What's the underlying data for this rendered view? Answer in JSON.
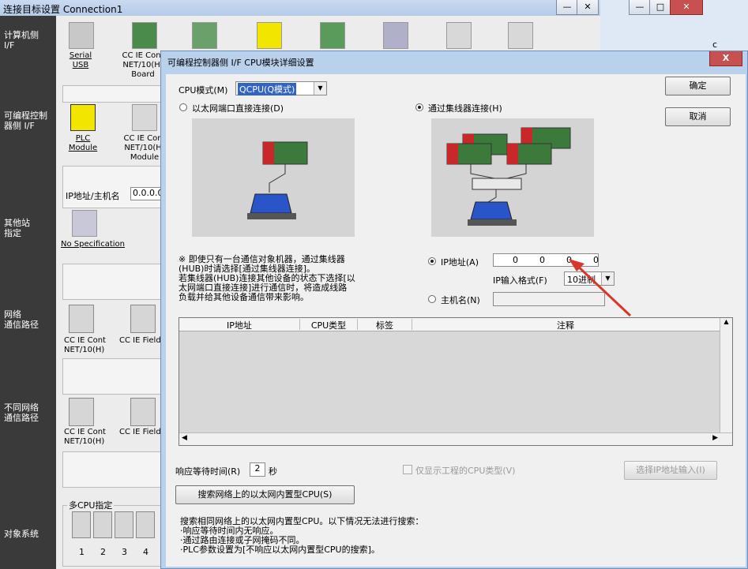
{
  "bg_window": {
    "title": "连接目标设置 Connection1",
    "nav": [
      "计算机侧\nI/F",
      "可编程控制\n器侧 I/F",
      "其他站\n指定",
      "网络\n通信路径",
      "不同网络\n通信路径",
      "对象系统"
    ],
    "pc_icons": [
      {
        "label": "Serial\nUSB"
      },
      {
        "label": "CC IE Cont\nNET/10(H)\nBoard"
      }
    ],
    "plc_icons": [
      {
        "label": "PLC\nModule"
      },
      {
        "label": "CC IE Cont\nNET/10(H)\nModule"
      }
    ],
    "ip_label": "IP地址/主机名",
    "ip_value": "0.0.0.0",
    "other_station_label": "No Specification",
    "network_icons": [
      {
        "label": "CC IE Cont\nNET/10(H)"
      },
      {
        "label": "CC IE Field"
      }
    ],
    "diff_network_icons": [
      {
        "label": "CC IE Cont\nNET/10(H)"
      },
      {
        "label": "CC IE Field"
      }
    ],
    "multi_cpu_label": "多CPU指定",
    "cpu_numbers": [
      "1",
      "2",
      "3",
      "4"
    ],
    "right_fragment": "c"
  },
  "dialog": {
    "title": "可编程控制器侧 I/F CPU模块详细设置",
    "close": "X",
    "ok_button": "确定",
    "cancel_button": "取消",
    "cpu_mode_label": "CPU模式(M)",
    "cpu_mode_value": "QCPU(Q模式)",
    "radio_direct": "以太网端口直接连接(D)",
    "radio_hub": "通过集线器连接(H)",
    "radio_direct_selected": false,
    "radio_hub_selected": true,
    "note_lines": [
      "※ 即使只有一台通信对象机器，通过集线器",
      "(HUB)时请选择[通过集线器连接]。",
      "若集线器(HUB)连接其他设备的状态下选择[以",
      "太网端口直接连接]进行通信时，将造成线路",
      "负载并给其他设备通信带来影响。"
    ],
    "ip_radio_label": "IP地址(A)",
    "ip_octets": [
      "0",
      "0",
      "0",
      "0"
    ],
    "ip_format_label": "IP输入格式(F)",
    "ip_format_value": "10进制",
    "host_radio_label": "主机名(N)",
    "host_value": "",
    "table_headers": [
      "IP地址",
      "CPU类型",
      "标签",
      "注释"
    ],
    "response_label": "响应等待时间(R)",
    "response_value": "2",
    "response_unit": "秒",
    "show_project_cpu_label": "仅显示工程的CPU类型(V)",
    "select_ip_button": "选择IP地址输入(I)",
    "search_button": "搜索网络上的以太网内置型CPU(S)",
    "search_notes": [
      "搜索相同网络上的以太网内置型CPU。以下情况无法进行搜索：",
      "·响应等待时间内无响应。",
      "·通过路由连接或子网掩码不同。",
      "·PLC参数设置为[不响应以太网内置型CPU的搜索]。"
    ]
  },
  "colors": {
    "accent_arrow": "#d9362b",
    "left_bar": "#3a3a3a",
    "selection": "#3264c8"
  }
}
